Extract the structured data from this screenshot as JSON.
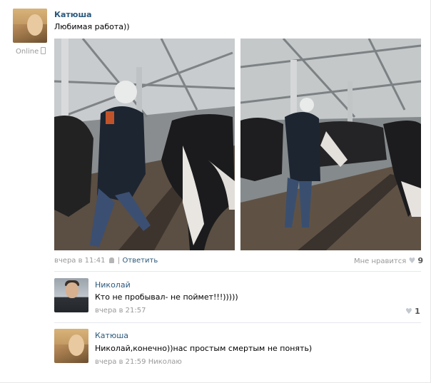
{
  "post": {
    "author": "Катюша",
    "online": "Online",
    "text": "Любимая работа))",
    "time": "вчера в 11:41",
    "separator": "|",
    "reply": "Ответить",
    "like_label": "Мне нравится",
    "like_count": "9"
  },
  "comments": [
    {
      "author": "Николай",
      "text": "Кто не пробывал- не поймет!!!)))))",
      "time": "вчера в 21:57",
      "like_count": "1"
    },
    {
      "author": "Катюша",
      "text": "Николай,конечно))нас простым смертым не понять)",
      "time": "вчера в 21:59",
      "reply_to": "Николаю"
    }
  ],
  "icons": {
    "heart": "♥",
    "android": "android-icon",
    "mobile": "mobile-phone-icon"
  },
  "colors": {
    "link": "#2b587a",
    "meta": "#999999",
    "heart": "#c3c9d0"
  }
}
